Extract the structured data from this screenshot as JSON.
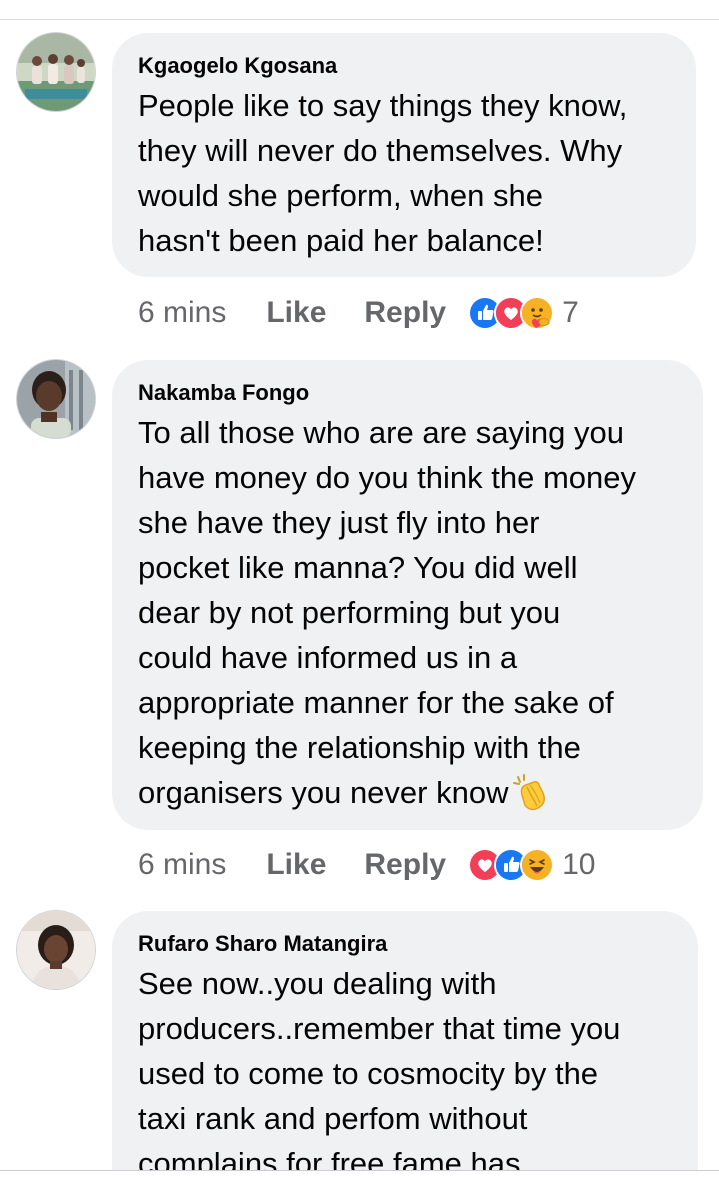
{
  "comments": [
    {
      "author": "Kgaogelo Kgosana",
      "lines": [
        "People like to say things they know,",
        "they will never do themselves. Why",
        "would she perform, when she",
        "hasn't been paid her balance!"
      ],
      "time": "6 mins",
      "like_label": "Like",
      "reply_label": "Reply",
      "reactions": [
        "like-reaction-icon",
        "love-reaction-icon",
        "care-reaction-icon"
      ],
      "reaction_count": "7"
    },
    {
      "author": "Nakamba Fongo",
      "lines": [
        "To all those who are are saying you",
        "have money do you think the money",
        "she have they just fly into her",
        "pocket like manna? You did well",
        "dear by not performing but you",
        "could have informed us in a",
        "appropriate manner  for the sake of",
        "keeping the relationship with the",
        "organisers  you never know"
      ],
      "trailing_emoji": "clapping-hands-emoji",
      "time": "6 mins",
      "like_label": "Like",
      "reply_label": "Reply",
      "reactions": [
        "love-reaction-icon",
        "like-reaction-icon",
        "haha-reaction-icon"
      ],
      "reaction_count": "10"
    },
    {
      "author": "Rufaro Sharo Matangira",
      "lines": [
        "See now..you dealing with",
        "producers..remember that time you",
        "used to come to cosmocity by the",
        "taxi rank and perfom without",
        "complains  for free  fame has"
      ]
    }
  ],
  "colors": {
    "bubble": "#eff1f3",
    "text": "#050505",
    "meta": "#65676b",
    "like_blue": "#1877f2",
    "love_red": "#f33e58",
    "care_yellow": "#f7b125"
  }
}
